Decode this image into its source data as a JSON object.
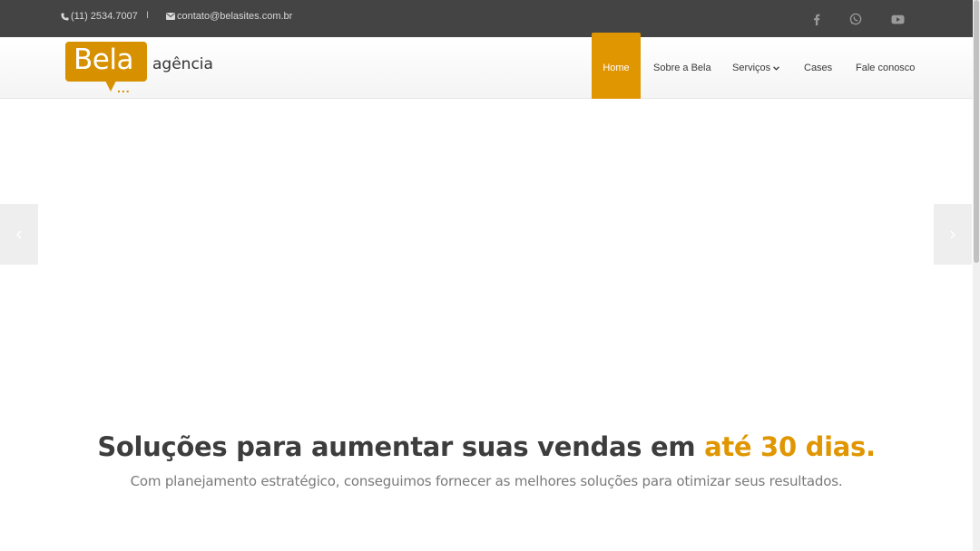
{
  "topbar": {
    "phone": "(11) 2534.7007",
    "separator": "I",
    "email": "contato@belasites.com.br",
    "social": [
      "facebook-icon",
      "whatsapp-icon",
      "youtube-icon"
    ]
  },
  "logo": {
    "word": "Bela",
    "dots": "...",
    "sub": "agência"
  },
  "nav": {
    "items": [
      {
        "label": "Home",
        "active": true
      },
      {
        "label": "Sobre a Bela"
      },
      {
        "label": "Serviços"
      },
      {
        "label": "Cases"
      },
      {
        "label": "Fale conosco"
      }
    ]
  },
  "hero": {
    "title_main": "Soluções para aumentar suas vendas em ",
    "title_accent": "até 30 dias.",
    "subtitle": "Com planejamento estratégico, conseguimos fornecer as melhores soluções para otimizar seus resultados."
  },
  "colors": {
    "accent": "#e09600",
    "topbar": "#444444",
    "text": "#3d3d3d"
  }
}
